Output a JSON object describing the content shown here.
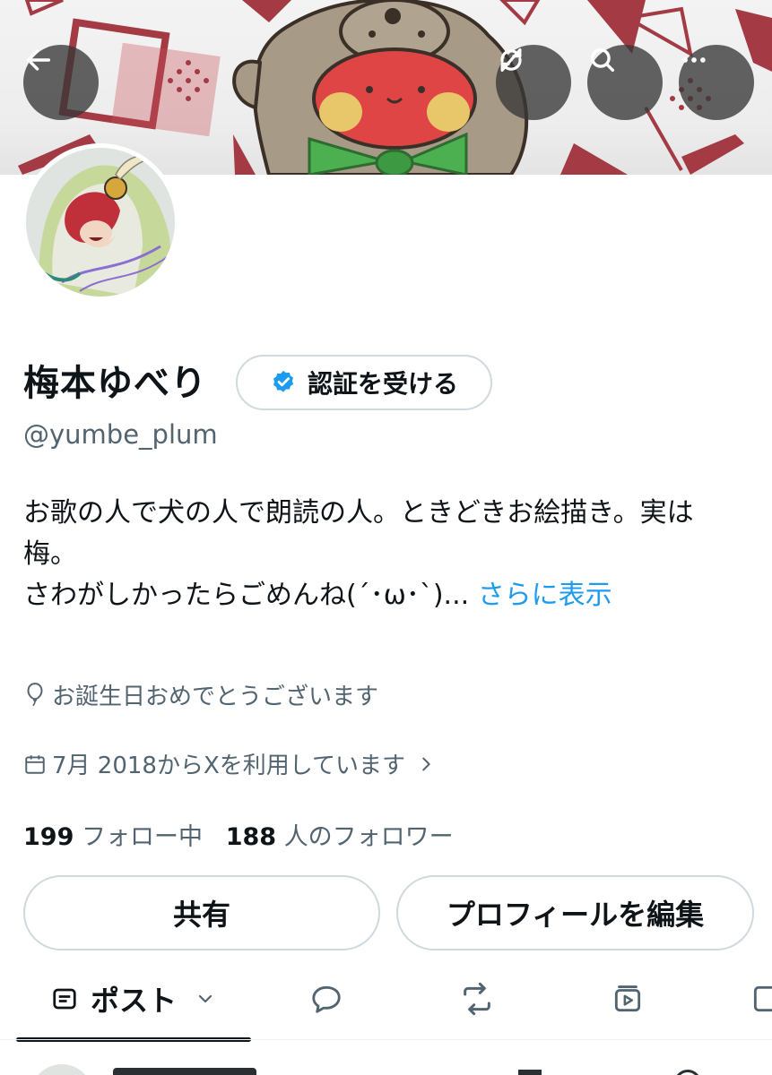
{
  "header": {
    "back_icon": "back-arrow-icon",
    "sync_icon": "sync-icon",
    "search_icon": "search-icon",
    "more_icon": "more-icon"
  },
  "profile": {
    "display_name": "梅本ゆべり",
    "verify_label": "認証を受ける",
    "handle": "@yumbe_plum",
    "bio_line1": "お歌の人で犬の人で朗読の人。ときどきお絵描き。実は",
    "bio_line2": "梅。",
    "bio_line3": "さわがしかったらごめんね(´･ω･`)...",
    "bio_more": "さらに表示",
    "birthday": "お誕生日おめでとうございます",
    "joined": "7月 2018からXを利用しています"
  },
  "stats": {
    "following_count": "199",
    "following_label": "フォロー中",
    "followers_count": "188",
    "followers_label": "人のフォロワー"
  },
  "actions": {
    "share_label": "共有",
    "edit_label": "プロフィールを編集"
  },
  "tabs": {
    "post_label": "ポスト"
  },
  "colors": {
    "accent": "#1d9bf0",
    "text": "#0f1419",
    "muted": "#536471",
    "border": "#cfd9de"
  }
}
